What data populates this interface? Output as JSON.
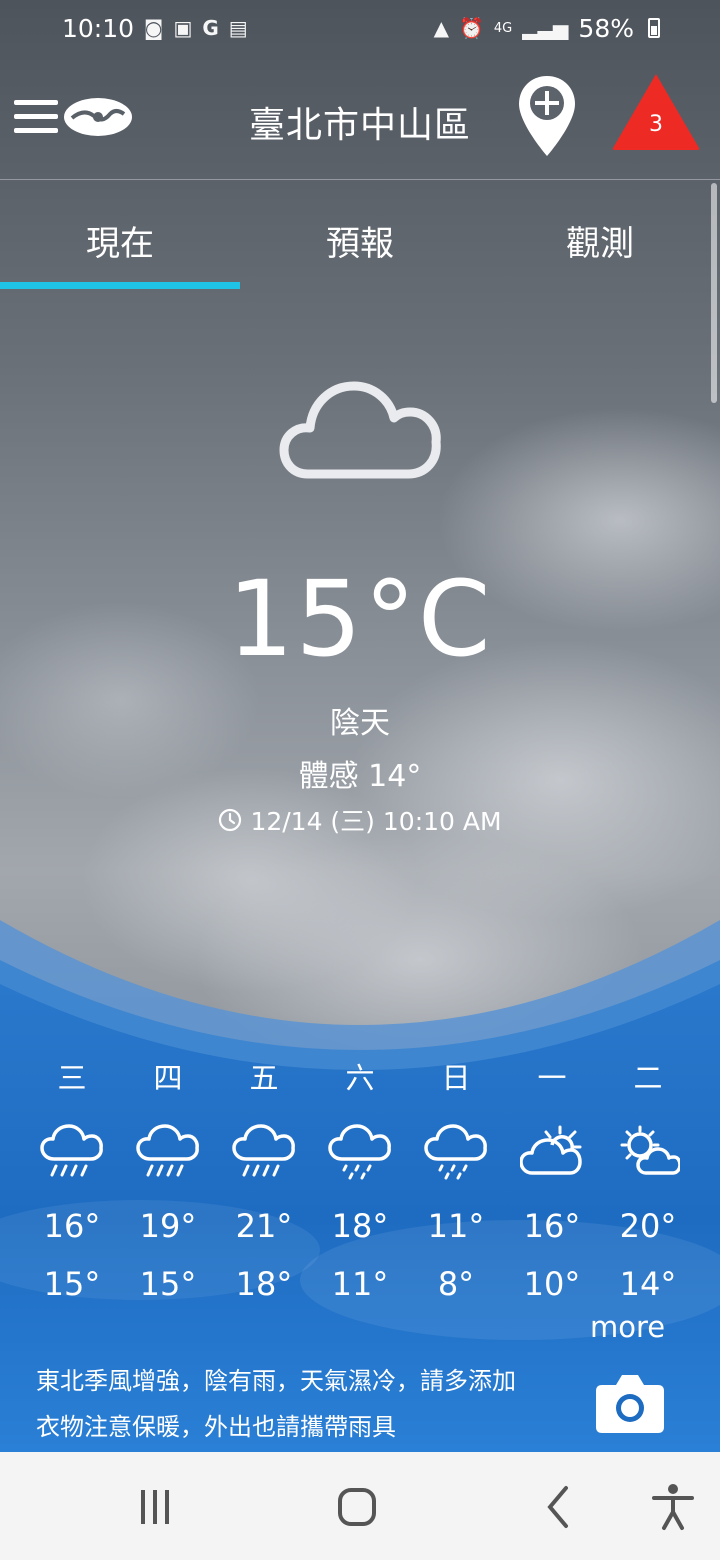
{
  "status_bar": {
    "time": "10:10",
    "network": "4G",
    "battery": "58%"
  },
  "header": {
    "location": "臺北市中山區",
    "alert_count": "3",
    "colors": {
      "alert": "#ee2a24"
    }
  },
  "tabs": [
    {
      "label": "現在",
      "active": true
    },
    {
      "label": "預報",
      "active": false
    },
    {
      "label": "觀測",
      "active": false
    }
  ],
  "current": {
    "icon": "cloud-icon",
    "temperature": "15°C",
    "condition": "陰天",
    "feels_like": "體感 14°",
    "updated": "12/14 (三) 10:10 AM"
  },
  "forecast": [
    {
      "day": "三",
      "icon": "rain-cloud-icon",
      "high": "16°",
      "low": "15°"
    },
    {
      "day": "四",
      "icon": "rain-cloud-icon",
      "high": "19°",
      "low": "15°"
    },
    {
      "day": "五",
      "icon": "rain-cloud-icon",
      "high": "21°",
      "low": "18°"
    },
    {
      "day": "六",
      "icon": "drizzle-cloud-icon",
      "high": "18°",
      "low": "11°"
    },
    {
      "day": "日",
      "icon": "drizzle-cloud-icon",
      "high": "11°",
      "low": "8°"
    },
    {
      "day": "一",
      "icon": "partly-cloudy-icon",
      "high": "16°",
      "low": "10°"
    },
    {
      "day": "二",
      "icon": "sunny-cloud-icon",
      "high": "20°",
      "low": "14°"
    }
  ],
  "more_label": "more",
  "advisory": {
    "line1": "東北季風增強，陰有雨，天氣濕冷，請多添加",
    "line2": "衣物注意保暖，外出也請攜帶雨具"
  },
  "colors": {
    "tab_indicator": "#1fc3e6",
    "panel_blue": "#1f6fc4"
  }
}
